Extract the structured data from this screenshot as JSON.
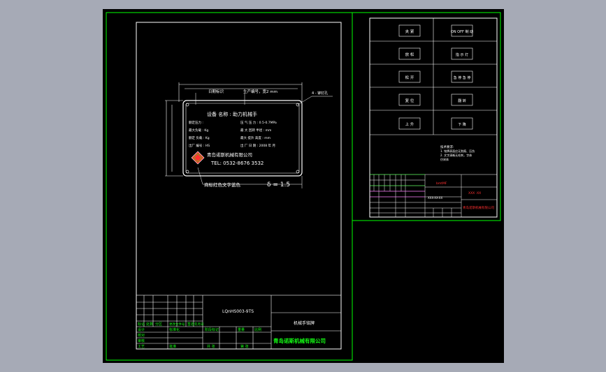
{
  "nameplate": {
    "header_left": "日期标识",
    "header_center": "生产编号，宽2 mm",
    "corner_note": "4 - 铆钉孔",
    "line1": "设备 名称 : 助力机械手",
    "row2_left": "额定压力 :",
    "row2_right": "压 气 压 力 : 0.5-0.7MPa",
    "row3_left": "最大负载 : Kg",
    "row3_right": "最 大 回转 半径 : mm",
    "row4_left": "额定 负载 : Kg",
    "row4_right": "最大 提升 高度 : mm",
    "row5_left": "出厂 编号 : HS",
    "row5_right": "出 厂 日 期 : 2008 年 月",
    "company": "青岛诺斯机械有限公司",
    "tel": "TEL: 0532-8676 3532",
    "callout": "商标红色文字蓝色",
    "thickness": "δ = 1.5"
  },
  "title_block": {
    "drawing_no": "LQnHS003-9TS",
    "drawing_name": "机械手铭牌",
    "company": "青岛诺斯机械有限公司",
    "designer_label": "设计",
    "checker_label": "校对",
    "reviewer_label": "审核",
    "process_label": "工艺",
    "standard_label": "标准化",
    "approve_label": "批准",
    "mark_label": "标记",
    "qty_label": "处数",
    "zone_label": "分区",
    "change_doc_label": "更改文件号",
    "sign_label": "签名",
    "date_label": "年月日",
    "stage_label": "阶段标记",
    "weight_label": "重量",
    "scale_label": "比例",
    "sheets_label": "共 张",
    "sheet_label": "第 张"
  },
  "buttons": [
    {
      "left": "夹 紧",
      "right": "ON  OFF 制 动"
    },
    {
      "left": "放 松",
      "right": "指 示 灯"
    },
    {
      "left": "松 开",
      "right": "急 停  急 停"
    },
    {
      "left": "复 位",
      "right": "翻 转"
    },
    {
      "left": "上 升",
      "right": "下 降"
    }
  ],
  "tech_notes": {
    "title": "技术要求:",
    "line1": "1. 铭牌表面应无划痕、压伤",
    "line2": "2. 文字清晰无毛刺，字体",
    "line3": "仿宋体"
  },
  "right_title_block": {
    "red_label": "bmtMF",
    "red_label2": "XXX -XX",
    "company": "青岛诺斯机械有限公司",
    "code": "XXX-XX-XX"
  },
  "colors": {
    "frame": "#00ff00",
    "line": "#ffffff",
    "bg": "#000000",
    "viewport_border": "#a6aab6"
  }
}
